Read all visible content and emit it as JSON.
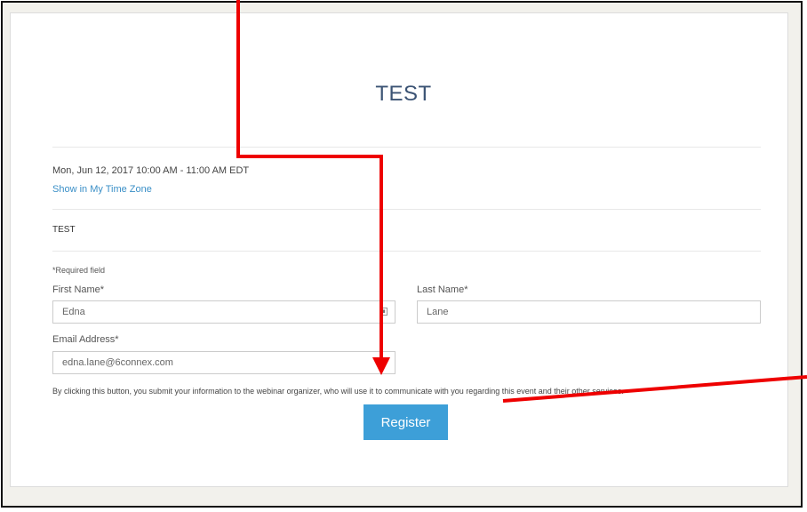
{
  "event": {
    "title": "TEST",
    "datetime": "Mon, Jun 12, 2017 10:00 AM - 11:00 AM EDT",
    "timezone_link": "Show in My Time Zone",
    "description": "TEST"
  },
  "form": {
    "required_note": "*Required field",
    "first_name": {
      "label": "First Name*",
      "value": "Edna"
    },
    "last_name": {
      "label": "Last Name*",
      "value": "Lane"
    },
    "email": {
      "label": "Email Address*",
      "value": "edna.lane@6connex.com"
    },
    "consent_text": "By clicking this button, you submit your information to the webinar organizer, who will use it to communicate with you regarding this event and their other services.",
    "register_label": "Register"
  },
  "annotation": {
    "arrow_color": "#ee0000"
  },
  "colors": {
    "accent": "#3d9fd8",
    "title": "#3b5374",
    "link": "#3a8fc7"
  }
}
